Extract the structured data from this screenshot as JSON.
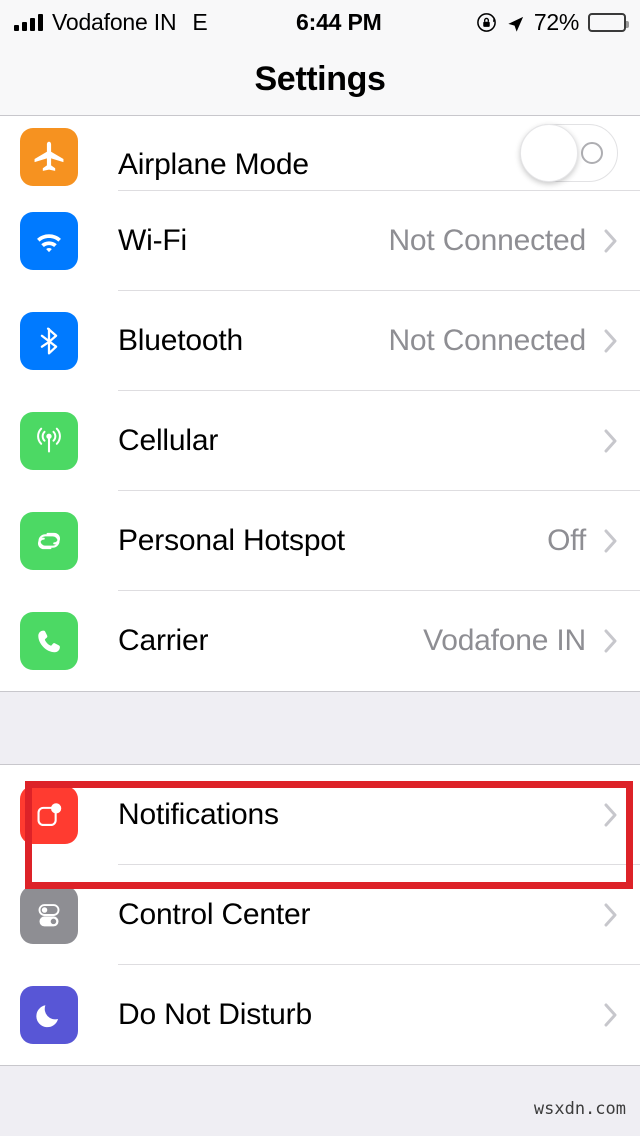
{
  "status_bar": {
    "carrier": "Vodafone IN",
    "network_type": "E",
    "time": "6:44 PM",
    "battery_percent": "72%",
    "battery_level": 72,
    "icons": [
      "signal-bars-icon",
      "rotation-lock-icon",
      "location-arrow-icon",
      "battery-icon"
    ]
  },
  "nav": {
    "title": "Settings"
  },
  "sections": [
    {
      "id": "connectivity",
      "rows": [
        {
          "label": "Airplane Mode",
          "icon": "airplane-icon",
          "icon_color": "#F69220",
          "control": "toggle",
          "toggle_on": false,
          "value": "",
          "clipped": true
        },
        {
          "label": "Wi-Fi",
          "icon": "wifi-icon",
          "icon_color": "#007AFF",
          "control": "chevron",
          "value": "Not Connected"
        },
        {
          "label": "Bluetooth",
          "icon": "bluetooth-icon",
          "icon_color": "#007AFF",
          "control": "chevron",
          "value": "Not Connected"
        },
        {
          "label": "Cellular",
          "icon": "cellular-icon",
          "icon_color": "#4CD964",
          "control": "chevron",
          "value": ""
        },
        {
          "label": "Personal Hotspot",
          "icon": "hotspot-icon",
          "icon_color": "#4CD964",
          "control": "chevron",
          "value": "Off"
        },
        {
          "label": "Carrier",
          "icon": "phone-icon",
          "icon_color": "#4CD964",
          "control": "chevron",
          "value": "Vodafone IN"
        }
      ]
    },
    {
      "id": "system",
      "rows": [
        {
          "label": "Notifications",
          "icon": "notifications-icon",
          "icon_color": "#FF3B30",
          "control": "chevron",
          "value": "",
          "highlighted": true
        },
        {
          "label": "Control Center",
          "icon": "control-center-icon",
          "icon_color": "#8E8E93",
          "control": "chevron",
          "value": ""
        },
        {
          "label": "Do Not Disturb",
          "icon": "do-not-disturb-icon",
          "icon_color": "#5856D6",
          "control": "chevron",
          "value": ""
        }
      ]
    }
  ],
  "annotation": {
    "target": "Notifications",
    "color": "#DD2228",
    "shape": "rectangle"
  },
  "watermark": "wsxdn.com"
}
